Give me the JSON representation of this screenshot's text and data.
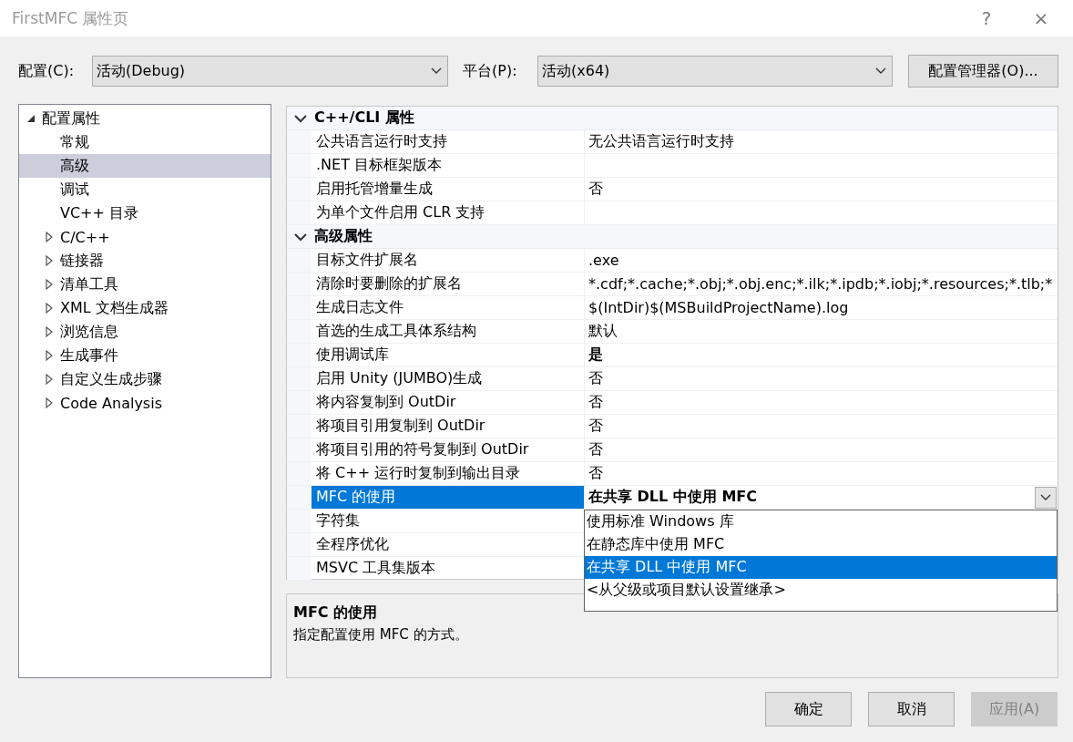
{
  "window": {
    "title": "FirstMFC 属性页",
    "help": "?",
    "close": "×"
  },
  "config_row": {
    "config_label": "配置(C):",
    "config_value": "活动(Debug)",
    "platform_label": "平台(P):",
    "platform_value": "活动(x64)",
    "manager_button": "配置管理器(O)..."
  },
  "tree": [
    {
      "label": "配置属性",
      "expanded": true,
      "selected": false,
      "children": [
        {
          "label": "常规",
          "selected": false
        },
        {
          "label": "高级",
          "selected": true
        },
        {
          "label": "调试",
          "selected": false
        },
        {
          "label": "VC++ 目录",
          "selected": false
        },
        {
          "label": "C/C++",
          "expanded": false,
          "selected": false
        },
        {
          "label": "链接器",
          "expanded": false,
          "selected": false
        },
        {
          "label": "清单工具",
          "expanded": false,
          "selected": false
        },
        {
          "label": "XML 文档生成器",
          "expanded": false,
          "selected": false
        },
        {
          "label": "浏览信息",
          "expanded": false,
          "selected": false
        },
        {
          "label": "生成事件",
          "expanded": false,
          "selected": false
        },
        {
          "label": "自定义生成步骤",
          "expanded": false,
          "selected": false
        },
        {
          "label": "Code Analysis",
          "expanded": false,
          "selected": false
        }
      ]
    }
  ],
  "sections": [
    {
      "title": "C++/CLI 属性",
      "expanded": true,
      "rows": [
        {
          "name": "公共语言运行时支持",
          "value": "无公共语言运行时支持",
          "selected": false
        },
        {
          "name": ".NET 目标框架版本",
          "selected": false
        },
        {
          "name": "启用托管增量生成",
          "value": "否",
          "selected": false
        },
        {
          "name": "为单个文件启用 CLR 支持",
          "selected": false
        }
      ]
    },
    {
      "title": "高级属性",
      "expanded": true,
      "rows": [
        {
          "name": "目标文件扩展名",
          "value": ".exe",
          "selected": false
        },
        {
          "name": "清除时要删除的扩展名",
          "value": "*.cdf;*.cache;*.obj;*.obj.enc;*.ilk;*.ipdb;*.iobj;*.resources;*.tlb;*",
          "selected": false
        },
        {
          "name": "生成日志文件",
          "value": "$(IntDir)$(MSBuildProjectName).log",
          "selected": false
        },
        {
          "name": "首选的生成工具体系结构",
          "value": "默认",
          "selected": false
        },
        {
          "name": "使用调试库",
          "value": "是",
          "bold": true,
          "selected": false
        },
        {
          "name": "启用 Unity (JUMBO)生成",
          "value": "否",
          "selected": false
        },
        {
          "name": "将内容复制到 OutDir",
          "value": "否",
          "selected": false
        },
        {
          "name": "将项目引用复制到 OutDir",
          "value": "否",
          "selected": false
        },
        {
          "name": "将项目引用的符号复制到 OutDir",
          "value": "否",
          "selected": false
        },
        {
          "name": "将 C++ 运行时复制到输出目录",
          "value": "否",
          "selected": false
        },
        {
          "name": "MFC 的使用",
          "value": "在共享 DLL 中使用 MFC",
          "bold": true,
          "selected": true,
          "dropdown": [
            {
              "label": "使用标准 Windows 库",
              "selected": false
            },
            {
              "label": "在静态库中使用 MFC",
              "selected": false
            },
            {
              "label": "在共享 DLL 中使用 MFC",
              "selected": true
            },
            {
              "label": "<从父级或项目默认设置继承>",
              "selected": false
            }
          ]
        },
        {
          "name": "字符集",
          "selected": false
        },
        {
          "name": "全程序优化",
          "selected": false
        },
        {
          "name": "MSVC 工具集版本",
          "selected": false
        }
      ]
    }
  ],
  "description": {
    "title": "MFC 的使用",
    "text": "指定配置使用 MFC 的方式。"
  },
  "buttons": [
    {
      "label": "确定",
      "disabled": false
    },
    {
      "label": "取消",
      "disabled": false
    },
    {
      "label": "应用(A)",
      "disabled": true
    }
  ]
}
